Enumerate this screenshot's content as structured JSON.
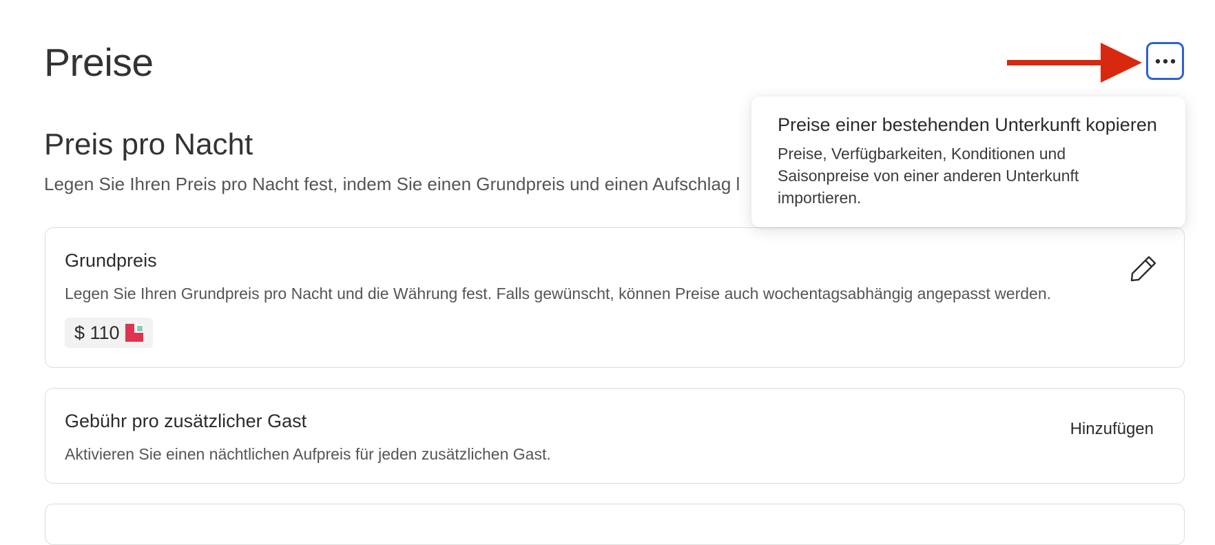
{
  "page": {
    "title": "Preise"
  },
  "header": {
    "more_button_icon": "ellipsis-horizontal-icon",
    "accent_color": "#2e5fd6",
    "annotation_arrow_color": "#d8280f"
  },
  "popover": {
    "title": "Preise einer bestehenden Unterkunft kopieren",
    "description": "Preise, Verfügbarkeiten, Konditionen und Saisonpreise von einer anderen Unterkunft importieren."
  },
  "section": {
    "title": "Preis pro Nacht",
    "description": "Legen Sie Ihren Preis pro Nacht fest, indem Sie einen Grundpreis und einen Aufschlag l"
  },
  "base_price_card": {
    "title": "Grundpreis",
    "description": "Legen Sie Ihren Grundpreis pro Nacht und die Währung fest. Falls gewünscht, können Preise auch wochentagsabhängig angepasst werden.",
    "price": "$ 110",
    "price_icon": "status-flag-icon",
    "edit_icon": "pencil-icon"
  },
  "extra_guest_card": {
    "title": "Gebühr pro zusätzlicher Gast",
    "description": "Aktivieren Sie einen nächtlichen Aufpreis für jeden zusätzlichen Gast.",
    "action_label": "Hinzufügen"
  }
}
